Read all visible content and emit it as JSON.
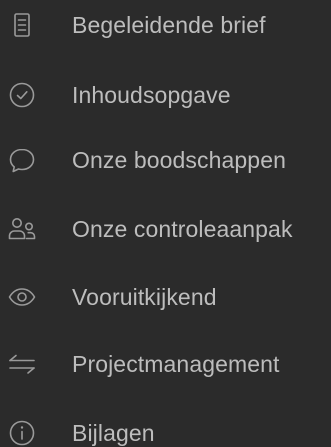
{
  "menu": {
    "items": [
      {
        "label": "Begeleidende brief",
        "icon": "document-icon"
      },
      {
        "label": "Inhoudsopgave",
        "icon": "check-circle-icon"
      },
      {
        "label": "Onze boodschappen",
        "icon": "speech-bubble-icon"
      },
      {
        "label": "Onze controleaanpak",
        "icon": "people-icon"
      },
      {
        "label": "Vooruitkijkend",
        "icon": "eye-icon"
      },
      {
        "label": "Projectmanagement",
        "icon": "swap-arrows-icon"
      },
      {
        "label": "Bijlagen",
        "icon": "info-icon"
      }
    ]
  },
  "colors": {
    "background": "#2b2b2b",
    "text": "#bdbdbd",
    "icon": "#9a9a9a"
  }
}
